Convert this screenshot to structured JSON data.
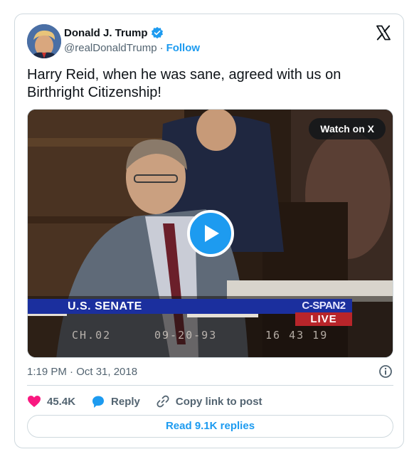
{
  "author": {
    "name": "Donald J. Trump",
    "handle": "@realDonaldTrump",
    "separator": "·",
    "follow_label": "Follow"
  },
  "tweet": {
    "text": "Harry Reid, when he was sane, agreed with us on Birthright Citizenship!",
    "timestamp": "1:19 PM · Oct 31, 2018"
  },
  "media": {
    "watch_label": "Watch on X",
    "senate_label": "U.S. SENATE",
    "network_label": "C-SPAN2",
    "live_label": "LIVE",
    "stamp_channel": "CH.02",
    "stamp_date": "09-20-93",
    "stamp_time": "16 43 19"
  },
  "engagement": {
    "likes": "45.4K",
    "reply_label": "Reply",
    "copy_label": "Copy link to post",
    "read_replies_label": "Read 9.1K replies"
  },
  "colors": {
    "accent": "#1d9bf0",
    "heart": "#f91880",
    "text": "#0f1419",
    "muted": "#536471",
    "border": "#cfd9de"
  },
  "icons": [
    "verified-badge-icon",
    "x-logo-icon",
    "play-icon",
    "info-icon",
    "heart-icon",
    "reply-bubble-icon",
    "link-icon"
  ]
}
